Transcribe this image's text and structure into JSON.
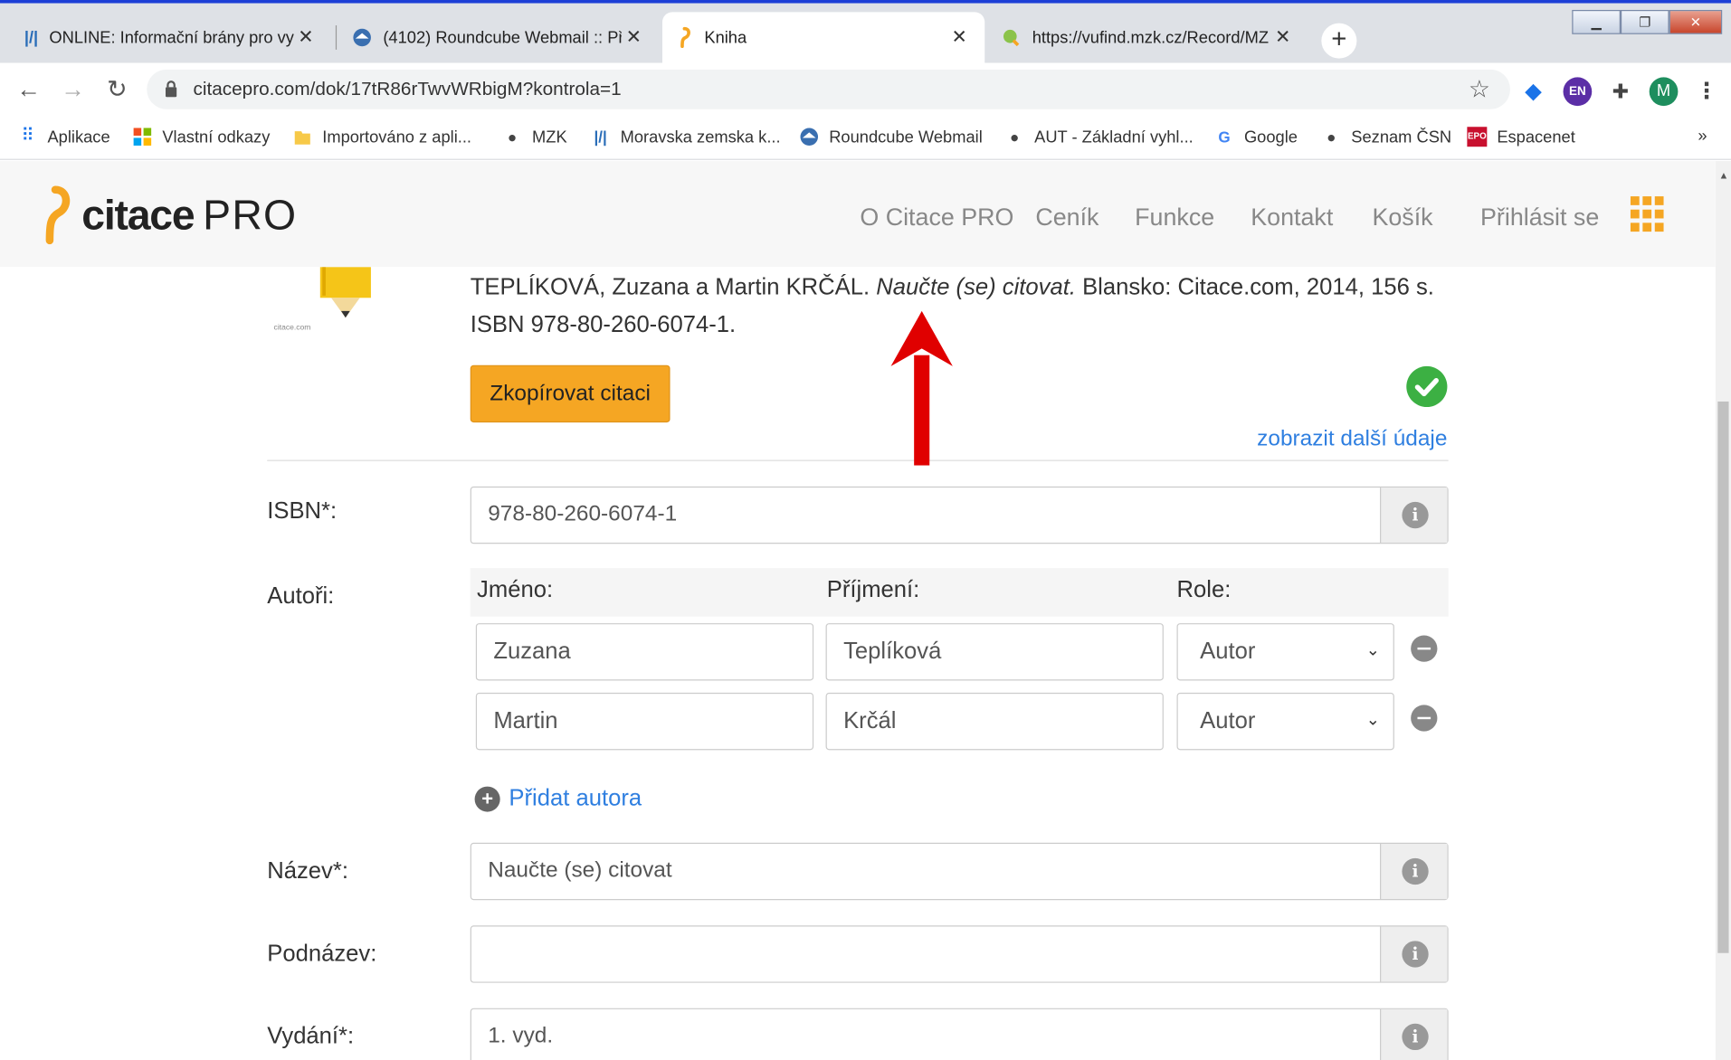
{
  "browser": {
    "tabs": [
      {
        "title": "ONLINE: Informační brány pro vy",
        "icon": "moravian-library-icon"
      },
      {
        "title": "(4102) Roundcube Webmail :: Pří",
        "icon": "roundcube-icon"
      },
      {
        "title": "Kniha",
        "icon": "citace-icon"
      },
      {
        "title": "https://vufind.mzk.cz/Record/MZ",
        "icon": "vufind-icon"
      }
    ],
    "active_tab_index": 2,
    "url": "citacepro.com/dok/17tR86rTwvWRbigM?kontrola=1",
    "profile_letter": "M",
    "ext_en": "EN",
    "bookmarks": [
      {
        "label": "Aplikace",
        "icon": "apps-grid-icon"
      },
      {
        "label": "Vlastní odkazy",
        "icon": "windows-icon"
      },
      {
        "label": "Importováno z apli...",
        "icon": "folder-icon"
      },
      {
        "label": "MZK",
        "icon": "globe-icon"
      },
      {
        "label": "Moravska zemska k...",
        "icon": "moravian-library-icon"
      },
      {
        "label": "Roundcube Webmail",
        "icon": "roundcube-icon"
      },
      {
        "label": "AUT - Základní vyhl...",
        "icon": "globe-icon"
      },
      {
        "label": "Google",
        "icon": "google-icon"
      },
      {
        "label": "Seznam ČSN",
        "icon": "globe-icon"
      },
      {
        "label": "Espacenet",
        "icon": "epo-icon"
      }
    ],
    "bookmarks_overflow": "»"
  },
  "site": {
    "logo_part1": "citace",
    "logo_part2": "PRO",
    "nav": [
      "O Citace PRO",
      "Ceník",
      "Funkce",
      "Kontakt",
      "Košík",
      "Přihlásit se"
    ]
  },
  "citation": {
    "authors_text": "TEPLÍKOVÁ, Zuzana a Martin KRČÁL.",
    "title_text": "Naučte (se) citovat.",
    "rest_text": "Blansko: Citace.com, 2014, 156 s. ISBN 978-80-260-6074-1.",
    "copy_button": "Zkopírovat citaci",
    "more_link": "zobrazit další údaje",
    "thumb_label": "citace.com"
  },
  "form": {
    "isbn_label": "ISBN*:",
    "isbn_value": "978-80-260-6074-1",
    "authors_label": "Autoři:",
    "col_first": "Jméno:",
    "col_last": "Příjmení:",
    "col_role": "Role:",
    "authors": [
      {
        "first": "Zuzana",
        "last": "Teplíková",
        "role": "Autor"
      },
      {
        "first": "Martin",
        "last": "Krčál",
        "role": "Autor"
      }
    ],
    "add_author": "Přidat autora",
    "title_label": "Název*:",
    "title_value": "Naučte (se) citovat",
    "subtitle_label": "Podnázev:",
    "subtitle_value": "",
    "edition_label": "Vydání*:",
    "edition_value": "1. vyd."
  },
  "colors": {
    "accent": "#f5a623",
    "link": "#2f7fe0",
    "success": "#3cb043",
    "annotation_arrow": "#e00000"
  }
}
